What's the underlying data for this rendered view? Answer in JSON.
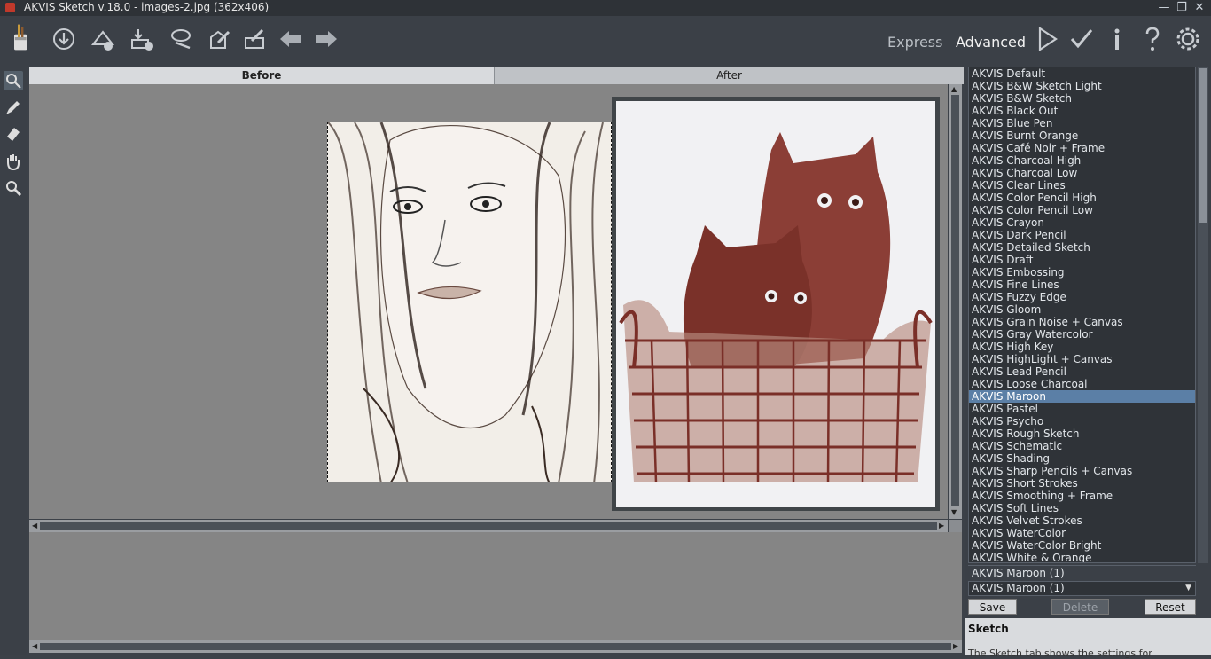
{
  "window": {
    "title": "AKVIS Sketch v.18.0 - images-2.jpg (362x406)",
    "min": "—",
    "max": "❐",
    "close": "✕"
  },
  "toolbar": {
    "buttons": [
      "logo",
      "open",
      "save",
      "print",
      "share",
      "load-settings",
      "save-settings",
      "undo",
      "redo"
    ],
    "modes": {
      "express": "Express",
      "advanced": "Advanced"
    },
    "right_icons": [
      "run",
      "apply",
      "info",
      "help",
      "settings"
    ]
  },
  "tabs": {
    "before": "Before",
    "after": "After"
  },
  "presets": {
    "items": [
      "AKVIS Default",
      "AKVIS B&W Sketch Light",
      "AKVIS B&W Sketch",
      "AKVIS Black Out",
      "AKVIS Blue Pen",
      "AKVIS Burnt Orange",
      "AKVIS Café Noir + Frame",
      "AKVIS Charcoal High",
      "AKVIS Charcoal Low",
      "AKVIS Clear Lines",
      "AKVIS Color Pencil High",
      "AKVIS Color Pencil Low",
      "AKVIS Crayon",
      "AKVIS Dark Pencil",
      "AKVIS Detailed Sketch",
      "AKVIS Draft",
      "AKVIS Embossing",
      "AKVIS Fine Lines",
      "AKVIS Fuzzy Edge",
      "AKVIS Gloom",
      "AKVIS Grain Noise + Canvas",
      "AKVIS Gray Watercolor",
      "AKVIS High Key",
      "AKVIS HighLight + Canvas",
      "AKVIS Lead Pencil",
      "AKVIS Loose Charcoal",
      "AKVIS Maroon",
      "AKVIS Pastel",
      "AKVIS Psycho",
      "AKVIS Rough Sketch",
      "AKVIS Schematic",
      "AKVIS Shading",
      "AKVIS Sharp Pencils + Canvas",
      "AKVIS Short Strokes",
      "AKVIS Smoothing + Frame",
      "AKVIS Soft Lines",
      "AKVIS Velvet Strokes",
      "AKVIS WaterColor",
      "AKVIS WaterColor Bright",
      "AKVIS White & Orange"
    ],
    "selected": "AKVIS Maroon",
    "custom": "AKVIS Maroon (1)",
    "combo_value": "AKVIS Maroon (1)",
    "save": "Save",
    "delete": "Delete",
    "reset": "Reset"
  },
  "sketch": {
    "heading": "Sketch",
    "description": "The Sketch tab shows the settings for"
  },
  "colors": {
    "accent": "#5b7fa6",
    "bg": "#3b4047",
    "canvas": "#858585"
  }
}
